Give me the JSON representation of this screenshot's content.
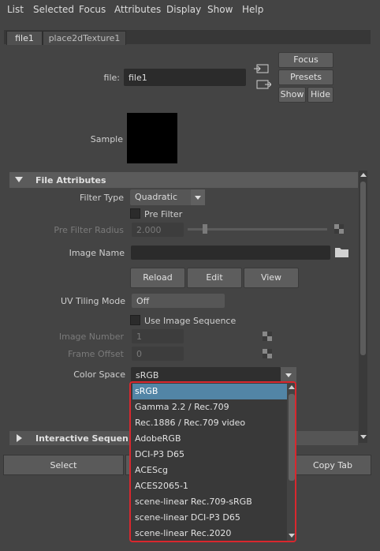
{
  "menu": [
    "List",
    "Selected",
    "Focus",
    "Attributes",
    "Display",
    "Show",
    "Help"
  ],
  "tabs": [
    "file1",
    "place2dTexture1"
  ],
  "node": {
    "label": "file:",
    "value": "file1",
    "focus": "Focus",
    "presets": "Presets",
    "show": "Show",
    "hide": "Hide",
    "sample": "Sample"
  },
  "section": {
    "title": "File Attributes",
    "filter_type_label": "Filter Type",
    "filter_type_value": "Quadratic",
    "pre_filter_label": "Pre Filter",
    "pre_filter_radius_label": "Pre Filter Radius",
    "pre_filter_radius_value": "2.000",
    "image_name_label": "Image Name",
    "image_name_value": "",
    "reload": "Reload",
    "edit": "Edit",
    "view": "View",
    "uv_tiling_label": "UV Tiling Mode",
    "uv_tiling_value": "Off",
    "use_image_sequence": "Use Image Sequence",
    "image_number_label": "Image Number",
    "image_number_value": "1",
    "frame_offset_label": "Frame Offset",
    "frame_offset_value": "0",
    "color_space_label": "Color Space",
    "color_space_value": "sRGB",
    "interactive_section": "Interactive Sequence Caching Options"
  },
  "dropdown": {
    "items": [
      "sRGB",
      "Gamma 2.2 / Rec.709",
      "Rec.1886 / Rec.709 video",
      "AdobeRGB",
      "DCI-P3 D65",
      "ACEScg",
      "ACES2065-1",
      "scene-linear Rec.709-sRGB",
      "scene-linear DCI-P3 D65",
      "scene-linear Rec.2020"
    ],
    "selected_index": 0
  },
  "bottom": {
    "select": "Select",
    "copy_tab": "Copy Tab"
  },
  "colors": {
    "accent_selected": "#5285a6",
    "dropdown_border": "#d9272e",
    "background": "#444444"
  }
}
